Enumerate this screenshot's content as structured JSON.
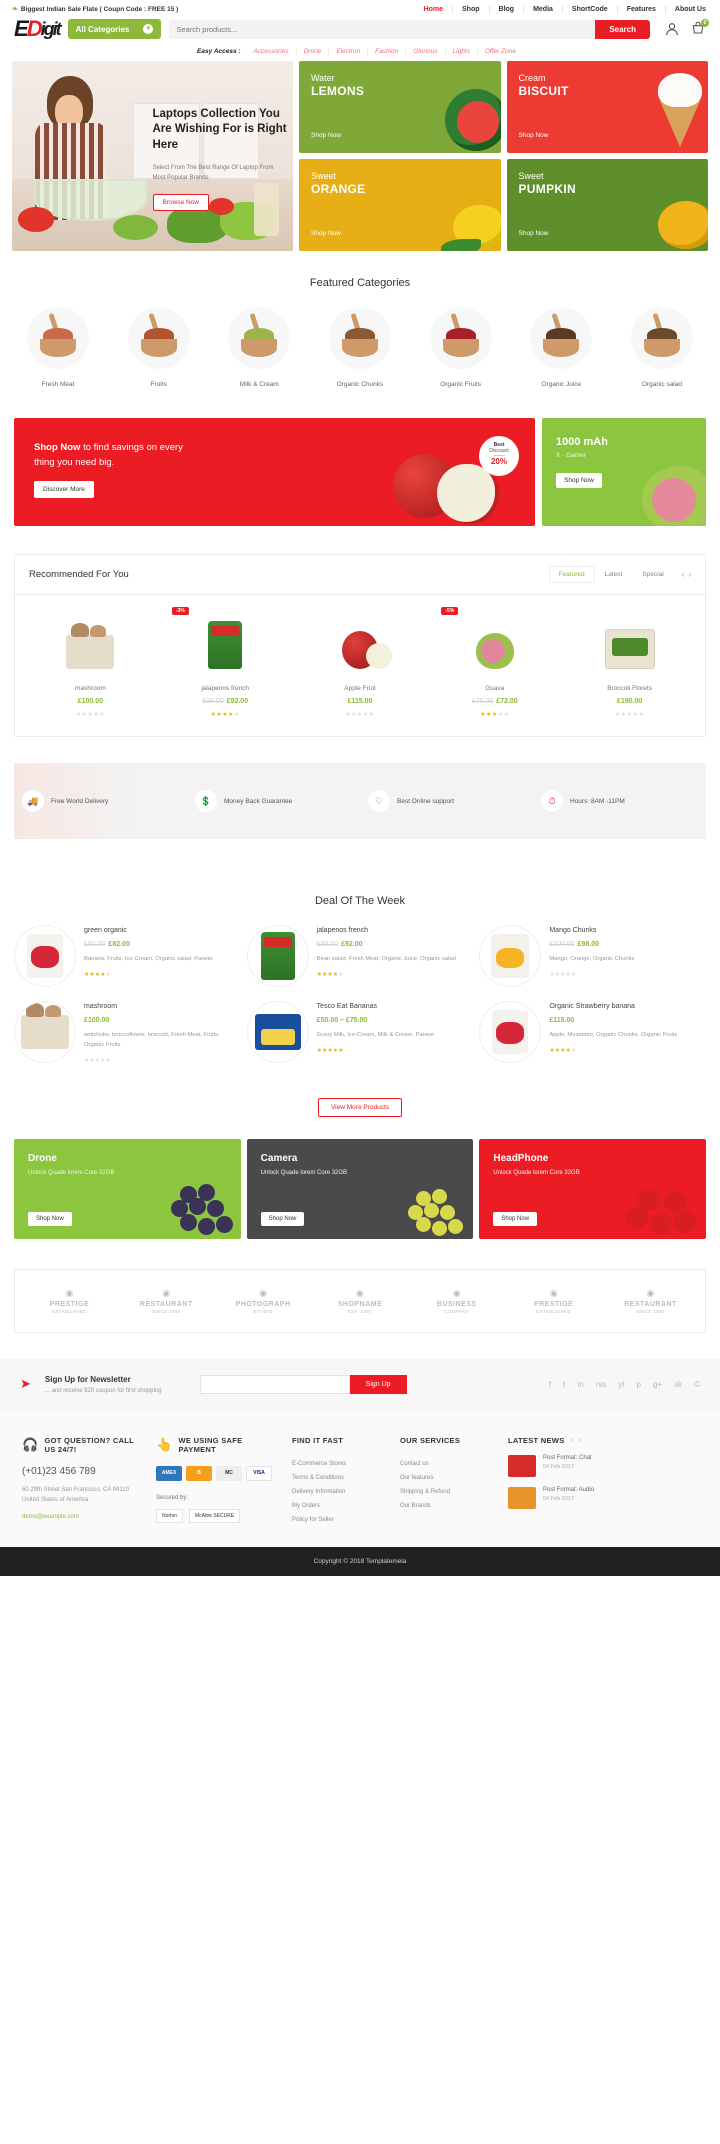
{
  "topbar": {
    "promo_text": "Biggest Indian Sale Flate ( Coupn Code : FREE 15 )",
    "nav": [
      {
        "label": "Home",
        "active": true
      },
      {
        "label": "Shop",
        "active": false
      },
      {
        "label": "Blog",
        "active": false
      },
      {
        "label": "Media",
        "active": false
      },
      {
        "label": "ShortCode",
        "active": false
      },
      {
        "label": "Features",
        "active": false
      },
      {
        "label": "About Us",
        "active": false
      }
    ]
  },
  "header": {
    "logo_e": "E",
    "logo_d": "D",
    "logo_rest": "igit",
    "category_select": "All Categories",
    "search_placeholder": "Search products...",
    "search_value": "",
    "search_button": "Search",
    "cart_count": "0"
  },
  "easy_access": {
    "label": "Easy Access :",
    "links": [
      "Accessories",
      "Drone",
      "Electron",
      "Fashion",
      "Glorious",
      "Lights",
      "Offer Zone"
    ]
  },
  "hero": {
    "title": "Laptops Collection You Are Wishing For is Right Here",
    "subtitle": "Select From The Best Range Of Laptop From Most Popular Brands",
    "button": "Browse Now"
  },
  "promos": [
    {
      "small": "Water",
      "big": "LEMONS",
      "cta": "Shop Now",
      "color": "green"
    },
    {
      "small": "Cream",
      "big": "BISCUIT",
      "cta": "Shop Now",
      "color": "red"
    },
    {
      "small": "Sweet",
      "big": "ORANGE",
      "cta": "Shop Now",
      "color": "yellow"
    },
    {
      "small": "Sweet",
      "big": "PUMPKIN",
      "cta": "Shop Now",
      "color": "dgreen"
    }
  ],
  "featured_categories": {
    "title": "Featured Categories",
    "items": [
      {
        "label": "Fresh Meat",
        "color": "#c96a4a"
      },
      {
        "label": "Fruits",
        "color": "#b2552f"
      },
      {
        "label": "Milk & Cream",
        "color": "#9db44a"
      },
      {
        "label": "Organic Chunks",
        "color": "#8a5a34"
      },
      {
        "label": "Organic Fruits",
        "color": "#a8202a"
      },
      {
        "label": "Organic Juice",
        "color": "#5c3a22"
      },
      {
        "label": "Organic salad",
        "color": "#6a4a2a"
      }
    ]
  },
  "mid_banners": {
    "big": {
      "line1_bold": "Shop Now",
      "line1_rest": " to find savings on every",
      "line2": "thing you need big.",
      "button": "Discover More",
      "badge_top": "Best",
      "badge_mid": "Discount",
      "badge_value": "20%"
    },
    "small": {
      "title": "1000 mAh",
      "subtitle": "X - Gamer",
      "button": "Shop Now"
    }
  },
  "recommended": {
    "title": "Recommended For You",
    "tabs": [
      {
        "label": "Featured",
        "active": true
      },
      {
        "label": "Latest",
        "active": false
      },
      {
        "label": "Special",
        "active": false
      }
    ],
    "prev": "‹",
    "next": "›",
    "products": [
      {
        "name": "mashroom",
        "price": "£100.00",
        "old_price": "",
        "sale": "",
        "stars": 0,
        "shape": "s-mush"
      },
      {
        "name": "jalapenos french",
        "price": "£92.00",
        "old_price": "£95.00",
        "sale": "-3%",
        "stars": 4,
        "shape": "s-pack"
      },
      {
        "name": "Apple Fruit",
        "price": "£115.00",
        "old_price": "",
        "sale": "",
        "stars": 0,
        "shape": "s-apple"
      },
      {
        "name": "Guava",
        "price": "£72.00",
        "old_price": "£76.00",
        "sale": "-5%",
        "stars": 3,
        "shape": "s-guava"
      },
      {
        "name": "Broccoli Florets",
        "price": "£190.00",
        "old_price": "",
        "sale": "",
        "stars": 0,
        "shape": "s-broc"
      }
    ]
  },
  "services": [
    {
      "label": "Free World Delivery",
      "icon": "truck-icon"
    },
    {
      "label": "Money Back Guarantee",
      "icon": "money-icon"
    },
    {
      "label": "Best Online support",
      "icon": "support-icon"
    },
    {
      "label": "Hours: 8AM -11PM",
      "icon": "clock-icon"
    }
  ],
  "deals": {
    "title": "Deal Of The Week",
    "items": [
      {
        "name": "green organic",
        "price": "£82.00",
        "old_price": "£85.00",
        "tags": "Banana, Fruits, Ice-Cream, Organic salad, Paneer",
        "stars": 4,
        "shape": "s-straw"
      },
      {
        "name": "jalapenos french",
        "price": "£92.00",
        "old_price": "£95.00",
        "tags": "Bean salad, Fresh Meat, Organic Juice, Organic salad",
        "stars": 4,
        "shape": "s-pack"
      },
      {
        "name": "Mango Chunks",
        "price": "£98.00",
        "old_price": "£100.00",
        "tags": "Mango, Orange, Organic Chunks",
        "stars": 0,
        "shape": "s-mango"
      },
      {
        "name": "mashroom",
        "price": "£100.00",
        "old_price": "",
        "tags": "amichoke, broccoflower, broccoli, Fresh Meat, Fruits, Organic Fruits",
        "stars": 0,
        "shape": "s-mush"
      },
      {
        "name": "Tesco Eat Bananas",
        "price": "£50.00 – £75.00",
        "old_price": "",
        "tags": "Gravy Milk, Ice-Cream, Milk & Cream, Paneer",
        "stars": 5,
        "shape": "s-banana"
      },
      {
        "name": "Organic Strawberry banana",
        "price": "£115.00",
        "old_price": "",
        "tags": "Apple, Mosambri, Organic Chunks, Organic Fruits",
        "stars": 4,
        "shape": "s-straw"
      }
    ],
    "view_more": "View More Products"
  },
  "category_banners": [
    {
      "title": "Drone",
      "subtitle": "Unlock Quade lorem Core 32GB",
      "button": "Shop Now",
      "color": "green"
    },
    {
      "title": "Camera",
      "subtitle": "Unlock Quade lorem Core 32GB",
      "button": "Shop Now",
      "color": "grey"
    },
    {
      "title": "HeadPhone",
      "subtitle": "Unlock Quade lorem Core 32GB",
      "button": "Shop Now",
      "color": "red"
    }
  ],
  "brands": [
    {
      "name": "PRESTIGE",
      "sub": "ESTABLISHED"
    },
    {
      "name": "RESTAURANT",
      "sub": "SINCE 1992"
    },
    {
      "name": "PHOTOGRAPH",
      "sub": "STUDIO"
    },
    {
      "name": "SHOPNAME",
      "sub": "EST. 1987"
    },
    {
      "name": "BUSINESS",
      "sub": "COMPANY"
    },
    {
      "name": "PRESTIGE",
      "sub": "ESTABLISHED"
    },
    {
      "name": "RESTAURANT",
      "sub": "SINCE 1992"
    }
  ],
  "newsletter": {
    "title": "Sign Up for Newsletter",
    "subtitle": "... and receive $20 coupon for first shopping",
    "placeholder": "",
    "value": "",
    "button": "Sign Up",
    "socials": [
      "f",
      "t",
      "in",
      "rss",
      "yt",
      "p",
      "g+",
      "sk",
      "©"
    ]
  },
  "footer": {
    "contact": {
      "heading": "GOT QUESTION? CALL US 24/7!",
      "phone": "(+01)23 456 789",
      "address": "60 29th Street San Francisco, CA 94110 United States of America",
      "email": "demo@example.com"
    },
    "payment": {
      "heading": "WE USING SAFE PAYMENT",
      "logos": [
        "AMEX",
        "B",
        "MC",
        "VISA"
      ],
      "secured_label": "Secured by:",
      "secured": [
        "Norton",
        "McAfee SECURE"
      ]
    },
    "find_it_fast": {
      "heading": "FIND IT FAST",
      "links": [
        "E-Commerce Stores",
        "Terms & Conditions",
        "Delivery Information",
        "My Orders",
        "Policy for Seller"
      ]
    },
    "our_services": {
      "heading": "OUR SERVICES",
      "links": [
        "Contact us",
        "Our features",
        "Shipping & Refund",
        "Our Brands"
      ]
    },
    "latest_news": {
      "heading": "LATEST NEWS",
      "items": [
        {
          "title": "Post Format: Chat",
          "date": "04 Feb 2017"
        },
        {
          "title": "Post Format: Audio",
          "date": "04 Feb 2017"
        }
      ]
    }
  },
  "copyright": "Copyright © 2018 Templatemela"
}
